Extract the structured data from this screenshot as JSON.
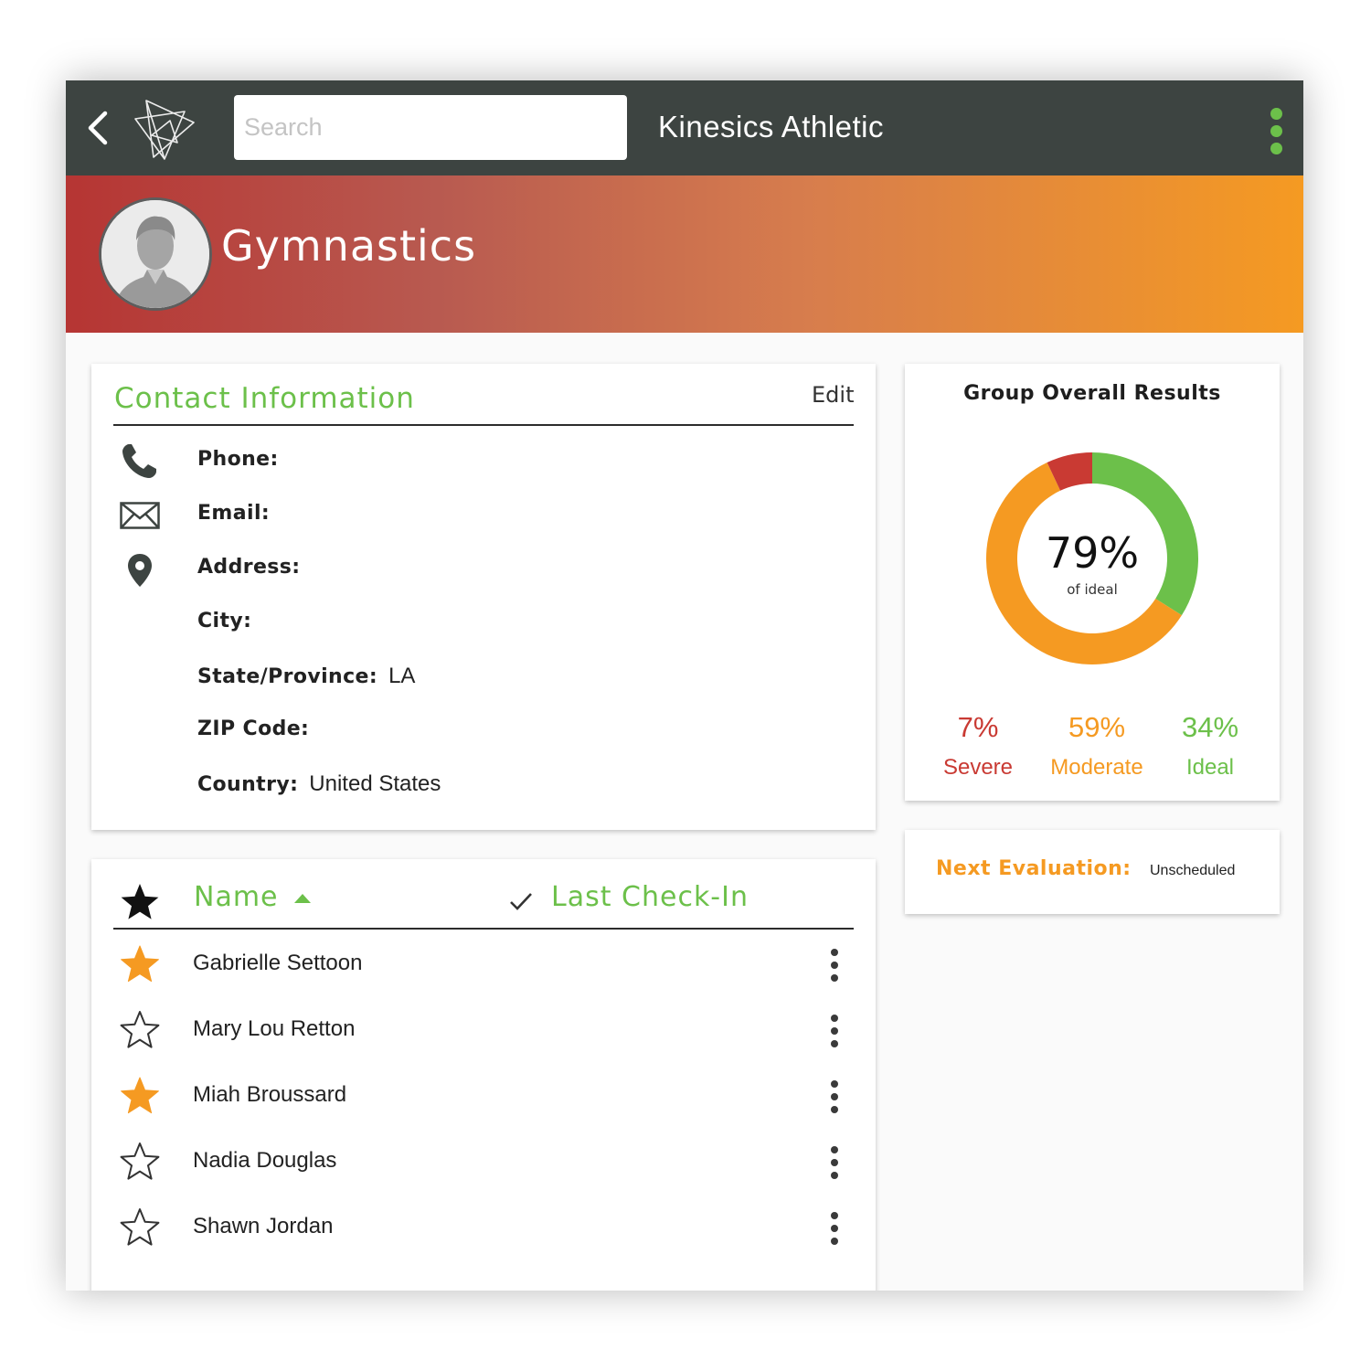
{
  "header": {
    "search_placeholder": "Search",
    "app_title": "Kinesics Athletic"
  },
  "banner": {
    "group_title": "Gymnastics"
  },
  "contact": {
    "heading": "Contact Information",
    "edit_label": "Edit",
    "fields": [
      {
        "label": "Phone:",
        "value": ""
      },
      {
        "label": "Email:",
        "value": ""
      },
      {
        "label": "Address:",
        "value": ""
      },
      {
        "label": "City:",
        "value": ""
      },
      {
        "label": "State/Province:",
        "value": "LA"
      },
      {
        "label": "ZIP Code:",
        "value": ""
      },
      {
        "label": "Country:",
        "value": "United States"
      }
    ]
  },
  "results": {
    "title": "Group Overall Results",
    "percent": "79%",
    "subtitle": "of ideal",
    "stats": [
      {
        "value": "7%",
        "label": "Severe",
        "color": "#c93a33"
      },
      {
        "value": "59%",
        "label": "Moderate",
        "color": "#f59a22"
      },
      {
        "value": "34%",
        "label": "Ideal",
        "color": "#6cc04a"
      }
    ]
  },
  "chart_data": {
    "type": "pie",
    "categories": [
      "Ideal",
      "Moderate",
      "Severe"
    ],
    "values": [
      34,
      59,
      7
    ],
    "colors": [
      "#6cc04a",
      "#f59a22",
      "#c93a33"
    ],
    "center_label": "79%"
  },
  "evaluation": {
    "label": "Next Evaluation:",
    "value": "Unscheduled"
  },
  "athletes": {
    "col_name": "Name",
    "col_checkin": "Last Check-In",
    "rows": [
      {
        "name": "Gabrielle Settoon",
        "favorite": true
      },
      {
        "name": "Mary Lou Retton",
        "favorite": false
      },
      {
        "name": "Miah Broussard",
        "favorite": true
      },
      {
        "name": "Nadia Douglas",
        "favorite": false
      },
      {
        "name": "Shawn Jordan",
        "favorite": false
      }
    ]
  },
  "colors": {
    "accent_green": "#6cc04a",
    "accent_orange": "#f59a22",
    "accent_red": "#c93a33",
    "topbar": "#3d4441"
  }
}
